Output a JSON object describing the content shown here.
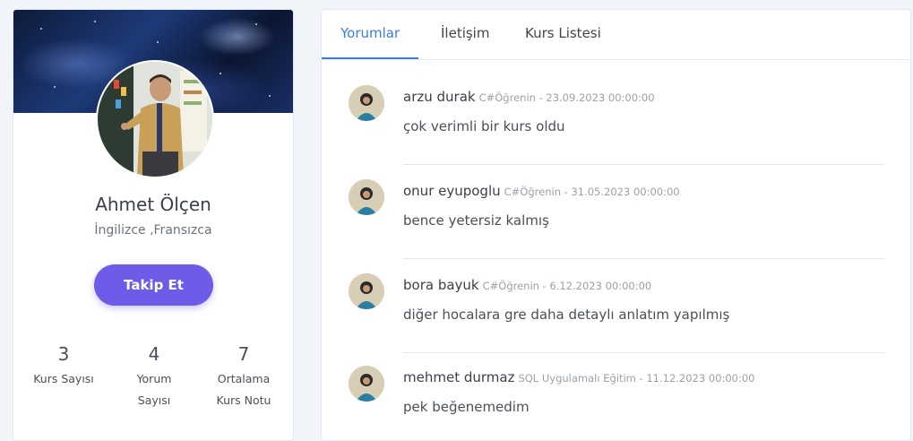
{
  "profile": {
    "name": "Ahmet Ölçen",
    "languages": "İngilizce ,Fransızca",
    "follow_label": "Takip Et",
    "stats": [
      {
        "value": "3",
        "label_line1": "Kurs Sayısı",
        "label_line2": ""
      },
      {
        "value": "4",
        "label_line1": "Yorum",
        "label_line2": "Sayısı"
      },
      {
        "value": "7",
        "label_line1": "Ortalama",
        "label_line2": "Kurs Notu"
      }
    ]
  },
  "tabs": [
    {
      "label": "Yorumlar",
      "active": true
    },
    {
      "label": "İletişim",
      "active": false
    },
    {
      "label": "Kurs Listesi",
      "active": false
    }
  ],
  "comments": [
    {
      "author": "arzu durak",
      "info": "C#Öğrenin - 23.09.2023 00:00:00",
      "text": "çok verimli bir kurs oldu"
    },
    {
      "author": "onur eyupoglu",
      "info": "C#Öğrenin - 31.05.2023 00:00:00",
      "text": "bence yetersiz kalmış"
    },
    {
      "author": "bora bayuk",
      "info": "C#Öğrenin - 6.12.2023 00:00:00",
      "text": "diğer hocalara gre daha detaylı anlatım yapılmış"
    },
    {
      "author": "mehmet durmaz",
      "info": "SQL Uygulamalı Eğitim - 11.12.2023 00:00:00",
      "text": "pek beğenemedim"
    }
  ],
  "colors": {
    "accent": "#3b7dd8",
    "follow_button": "#6c5ce7"
  }
}
